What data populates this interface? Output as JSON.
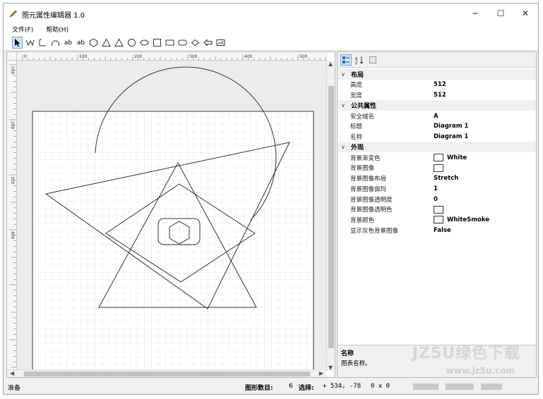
{
  "window": {
    "title": "图元属性编辑器 1.0",
    "minimize": "─",
    "maximize": "☐",
    "close": "✕"
  },
  "menu": [
    {
      "label": "文件(F)"
    },
    {
      "label": "帮助(H)"
    }
  ],
  "toolbar": {
    "tools": [
      {
        "icon": "pointer-icon"
      },
      {
        "icon": "polyline-icon"
      },
      {
        "icon": "step-line-icon"
      },
      {
        "icon": "arc-icon"
      },
      {
        "icon": "text-icon",
        "label": "ab"
      },
      {
        "icon": "text-box-icon",
        "label": "ab"
      },
      {
        "icon": "hexagon-icon"
      },
      {
        "icon": "triangle-icon"
      },
      {
        "icon": "triangle-outline-icon"
      },
      {
        "icon": "circle-icon"
      },
      {
        "icon": "ellipse-icon"
      },
      {
        "icon": "square-icon"
      },
      {
        "icon": "rectangle-icon"
      },
      {
        "icon": "rounded-rect-icon"
      },
      {
        "icon": "diamond-icon"
      },
      {
        "icon": "arrow-shape-icon"
      },
      {
        "icon": "image-icon"
      }
    ]
  },
  "ruler": {
    "top_ticks": [
      "0",
      "100",
      "200",
      "300",
      "400",
      "500"
    ],
    "left_ticks": [
      "100",
      "200",
      "300",
      "400"
    ]
  },
  "properties": {
    "categories": [
      {
        "name": "布局",
        "rows": [
          {
            "key": "高度",
            "value": "512"
          },
          {
            "key": "宽度",
            "value": "512"
          }
        ]
      },
      {
        "name": "公共属性",
        "rows": [
          {
            "key": "安全域名",
            "value": "A"
          },
          {
            "key": "标题",
            "value": "Diagram 1"
          },
          {
            "key": "名称",
            "value": "Diagram 1"
          }
        ]
      },
      {
        "name": "外观",
        "rows": [
          {
            "key": "背景渐变色",
            "value": "White",
            "swatch": "#ffffff"
          },
          {
            "key": "背景图像",
            "value": "",
            "swatch": "#ffffff"
          },
          {
            "key": "背景图像布局",
            "value": "Stretch"
          },
          {
            "key": "背景图像伽玛",
            "value": "1"
          },
          {
            "key": "背景图像透明度",
            "value": "0"
          },
          {
            "key": "背景图像透明色",
            "value": "",
            "swatch": "#ffffff"
          },
          {
            "key": "背景颜色",
            "value": "WhiteSmoke",
            "swatch": "#f5f5f5"
          },
          {
            "key": "显示灰色背景图像",
            "value": "False"
          }
        ]
      }
    ],
    "description": {
      "title": "名称",
      "text": "图表名称。"
    }
  },
  "status": {
    "ready": "准备",
    "shape_count_label": "图形数目:",
    "shape_count": "6",
    "selection_label": "选择:",
    "coordinates": "+ 534, -78",
    "size": "0 x 0"
  },
  "watermark": {
    "brand": "JZ5U绿色下载",
    "url": "www.jz5u.com"
  },
  "colors": {
    "grid_line": "#d4d4d4",
    "shape_stroke": "#333333",
    "selection": "#cde3f8"
  }
}
